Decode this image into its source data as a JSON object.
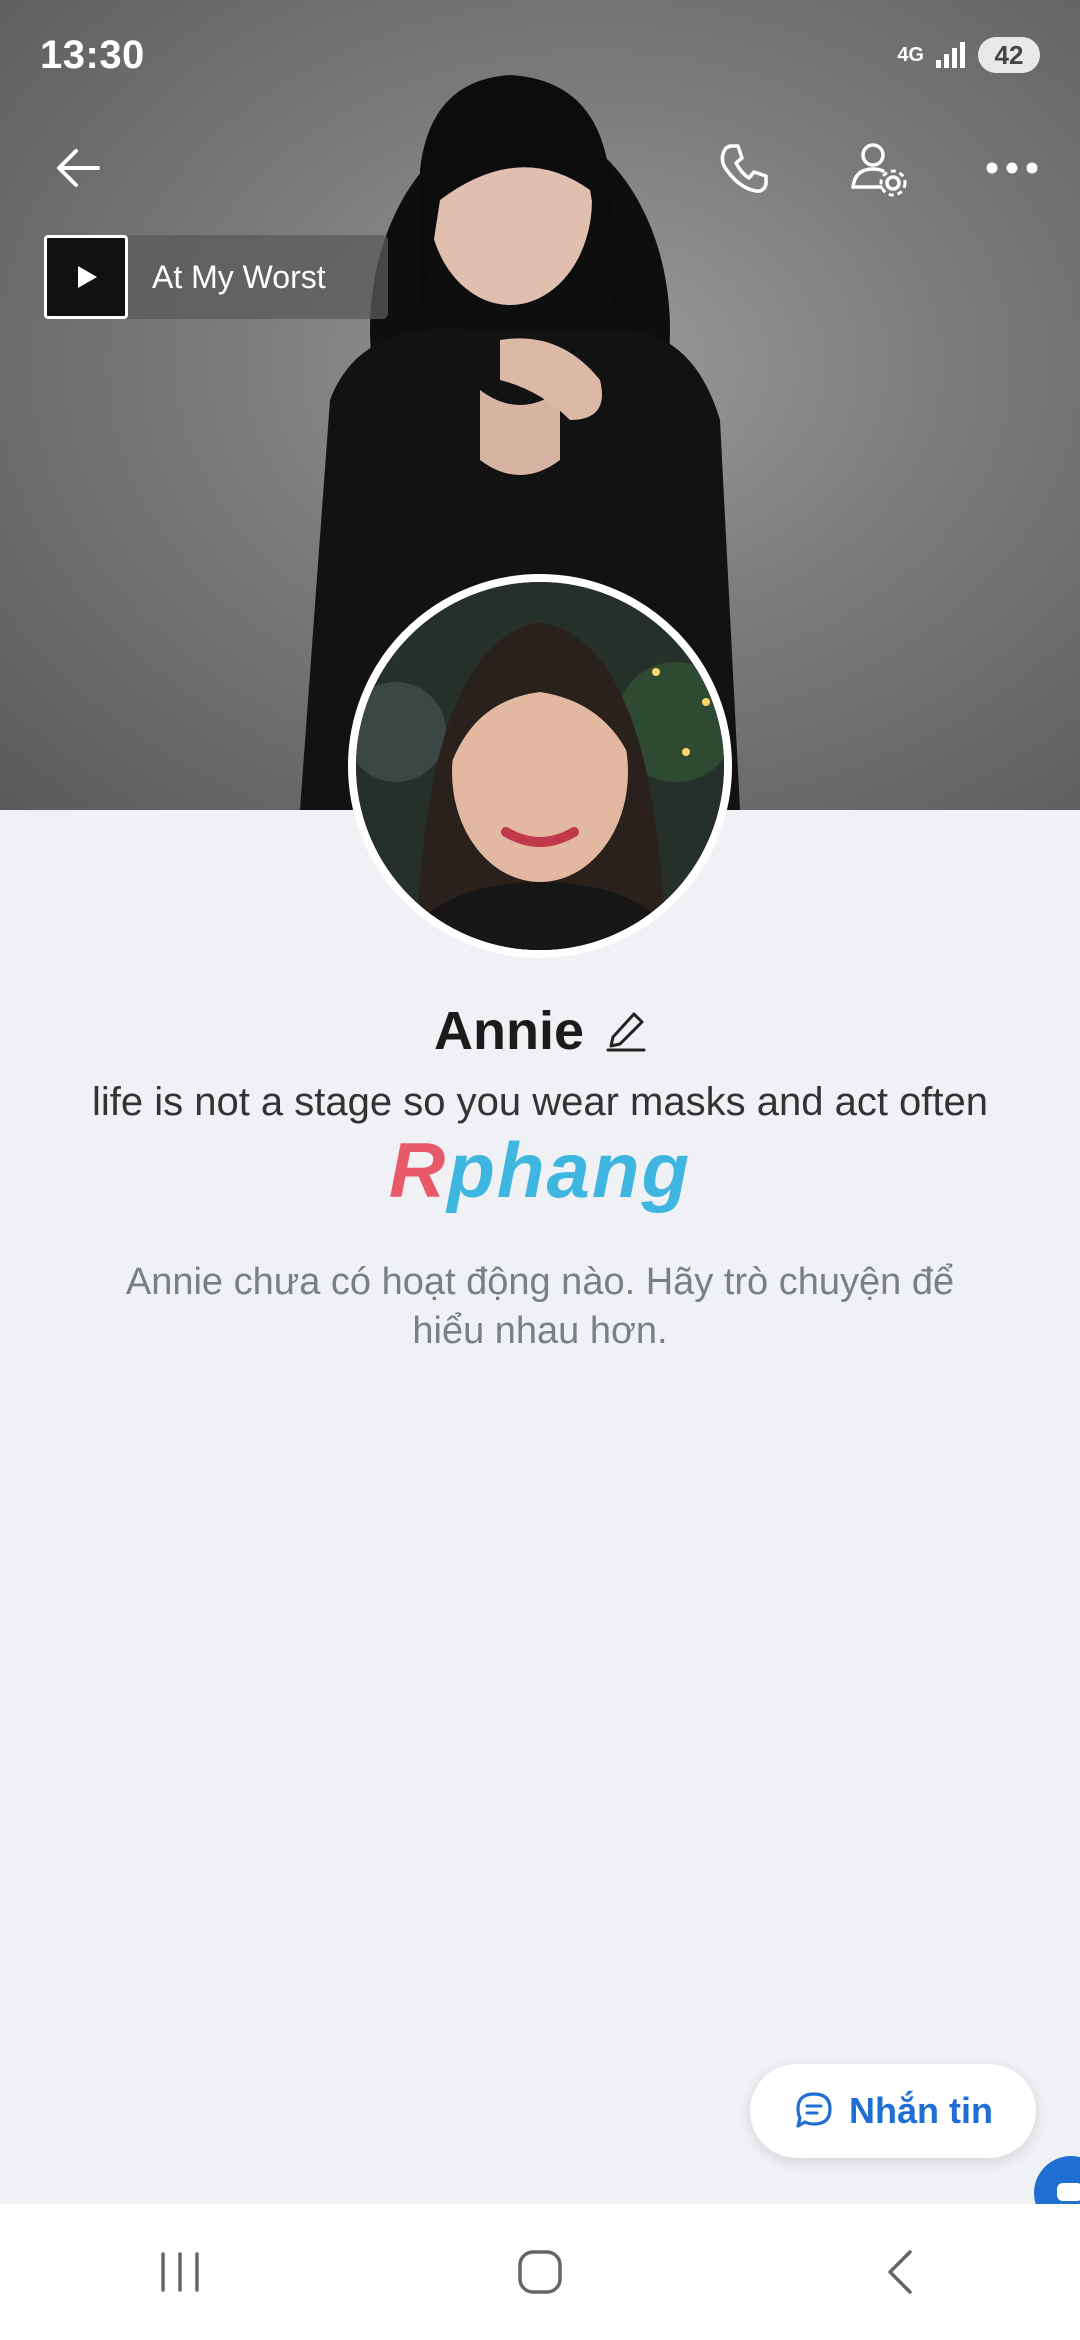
{
  "status_bar": {
    "time": "13:30",
    "network": "4G",
    "battery": "42"
  },
  "header": {
    "icons": [
      "back-arrow-icon",
      "phone-icon",
      "user-settings-icon",
      "more-icon"
    ]
  },
  "music": {
    "title": "At My Worst"
  },
  "profile": {
    "name": "Annie",
    "bio": "life is not a stage so you wear masks and act often",
    "watermark_left": "R",
    "watermark_right": "phang",
    "empty_state": "Annie chưa có hoạt động nào. Hãy trò chuyện để hiểu nhau hơn."
  },
  "actions": {
    "message_label": "Nhắn tin"
  },
  "colors": {
    "accent": "#1e6ed4",
    "page_bg": "#f0f1f5"
  }
}
